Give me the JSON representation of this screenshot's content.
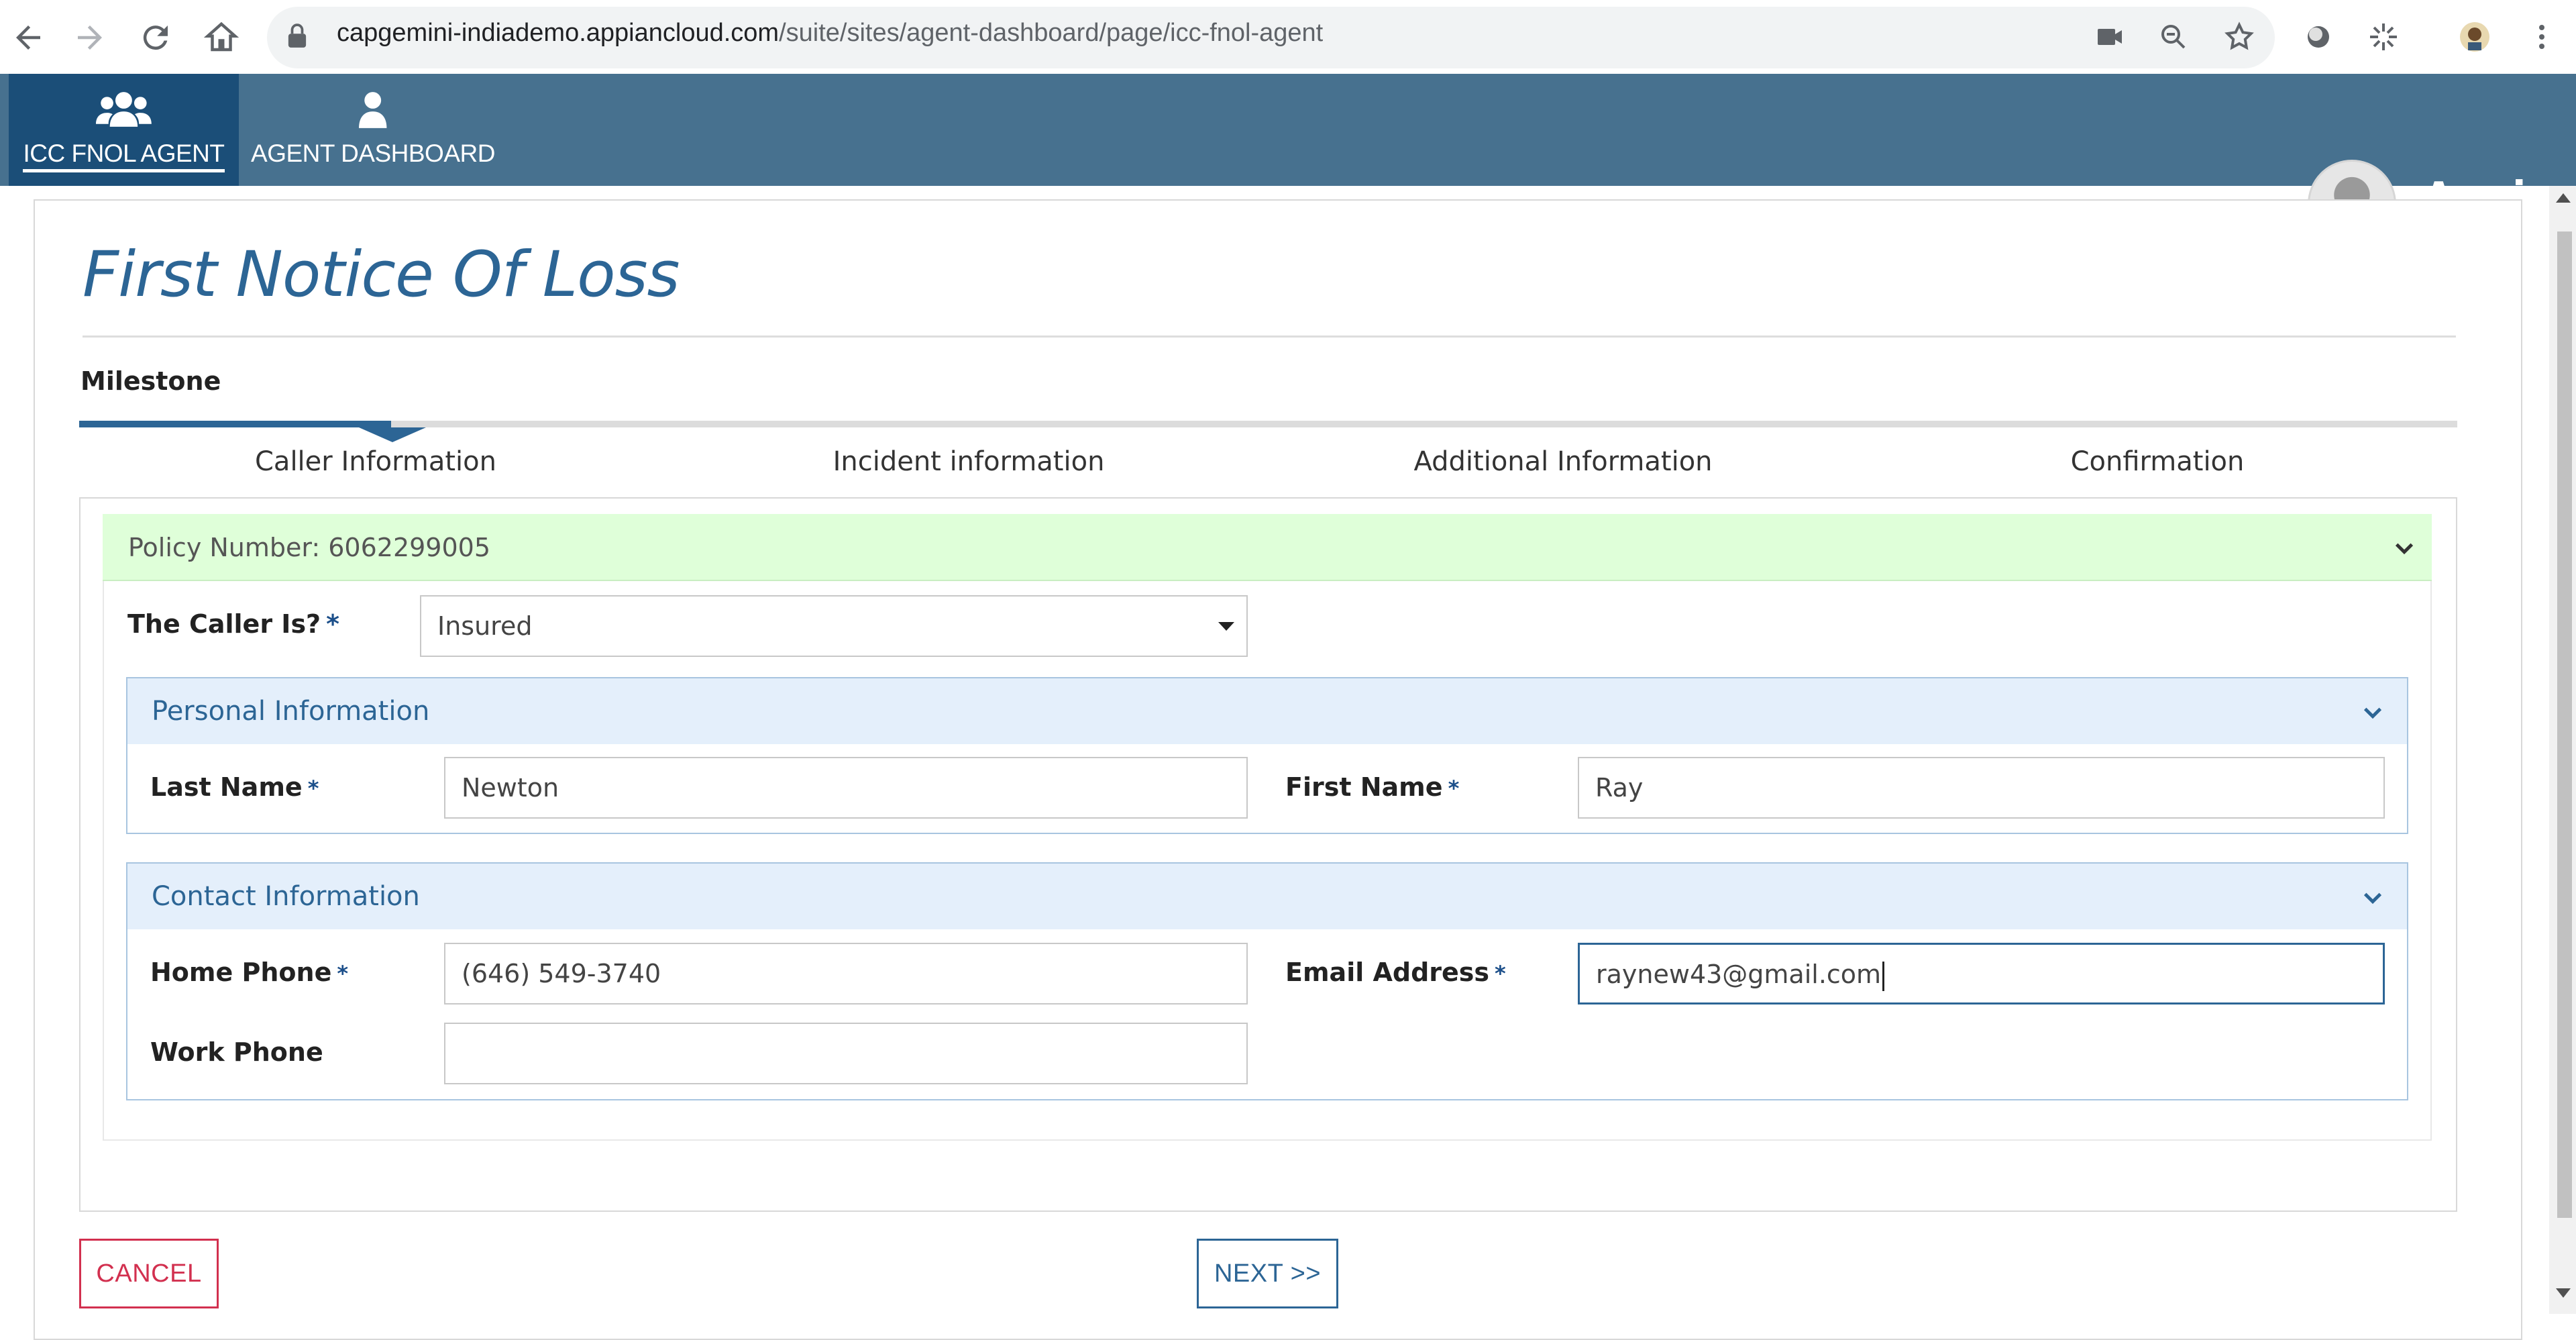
{
  "browser": {
    "url_host": "capgemini-indiademo.appiancloud.com",
    "url_path": "/suite/sites/agent-dashboard/page/icc-fnol-agent"
  },
  "nav": {
    "tabs": [
      {
        "label": "ICC FNOL AGENT",
        "icon": "group-icon",
        "active": true
      },
      {
        "label": "AGENT DASHBOARD",
        "icon": "person-icon",
        "active": false
      }
    ],
    "brand": "Appian"
  },
  "page": {
    "title": "First Notice Of Loss",
    "milestone_label": "Milestone",
    "steps": [
      "Caller Information",
      "Incident information",
      "Additional Information",
      "Confirmation"
    ],
    "active_step": 0
  },
  "form": {
    "policy_label": "Policy Number: 6062299005",
    "caller_is": {
      "label": "The Caller Is?",
      "required_mark": "*",
      "value": "Insured"
    },
    "personal": {
      "title": "Personal Information",
      "last_name": {
        "label": "Last Name",
        "value": "Newton"
      },
      "first_name": {
        "label": "First Name",
        "value": "Ray"
      }
    },
    "contact": {
      "title": "Contact Information",
      "home_phone": {
        "label": "Home Phone",
        "value": "(646) 549-3740"
      },
      "email": {
        "label": "Email Address",
        "value": "raynew43@gmail.com"
      },
      "work_phone": {
        "label": "Work Phone",
        "value": ""
      }
    },
    "required_mark": "*"
  },
  "actions": {
    "cancel_label": "CANCEL",
    "next_label": "NEXT >>"
  },
  "colors": {
    "nav_bg": "#47718f",
    "nav_active": "#1b4e78",
    "accent": "#2c6595",
    "policy_bg": "#dfffd9",
    "cancel": "#d2304f"
  }
}
